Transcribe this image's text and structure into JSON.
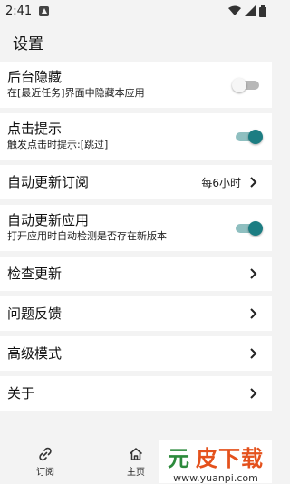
{
  "status": {
    "time": "2:41"
  },
  "appbar": {
    "title": "设置"
  },
  "settings": [
    {
      "title": "后台隐藏",
      "subtitle": "在[最近任务]界面中隐藏本应用",
      "toggle": "off"
    },
    {
      "title": "点击提示",
      "subtitle": "触发点击时提示:[跳过]",
      "toggle": "on"
    },
    {
      "title": "自动更新订阅",
      "value": "每6小时"
    },
    {
      "title": "自动更新应用",
      "subtitle": "打开应用时自动检测是否存在新版本",
      "toggle": "on"
    },
    {
      "title": "检查更新"
    },
    {
      "title": "问题反馈"
    },
    {
      "title": "高级模式"
    },
    {
      "title": "关于"
    }
  ],
  "bottom_nav": [
    {
      "label": "订阅",
      "icon": "link-icon"
    },
    {
      "label": "主页",
      "icon": "home-icon"
    }
  ],
  "watermark": {
    "text_a": "元",
    "text_b": "皮下载",
    "url": "www.yuanpi.com"
  },
  "colors": {
    "accent": "#1c7d82",
    "background": "#f3f3f3",
    "card": "#ffffff"
  }
}
